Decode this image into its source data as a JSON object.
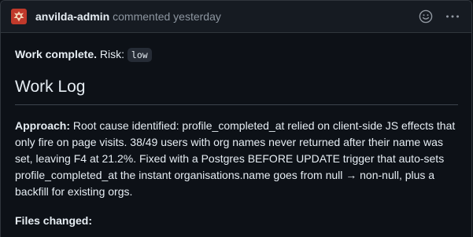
{
  "comment": {
    "author": "anvilda-admin",
    "meta": "commented yesterday",
    "icons": {
      "avatar": "avatar-logo-icon",
      "reaction": "smiley-icon",
      "menu": "kebab-horizontal-icon"
    },
    "colors": {
      "avatar_bg": "#c0392b",
      "header_bg": "#161b22",
      "page_bg": "#0d1117"
    }
  },
  "body": {
    "summary_label": "Work complete.",
    "risk_label": "Risk:",
    "risk_value": "low",
    "heading": "Work Log",
    "approach_label": "Approach:",
    "approach_text": "Root cause identified: profile_completed_at relied on client-side JS effects that only fire on page visits. 38/49 users with org names never returned after their name was set, leaving F4 at 21.2%. Fixed with a Postgres BEFORE UPDATE trigger that auto-sets profile_completed_at the instant organisations.name goes from null → non-null, plus a backfill for existing orgs.",
    "files_label": "Files changed:"
  }
}
